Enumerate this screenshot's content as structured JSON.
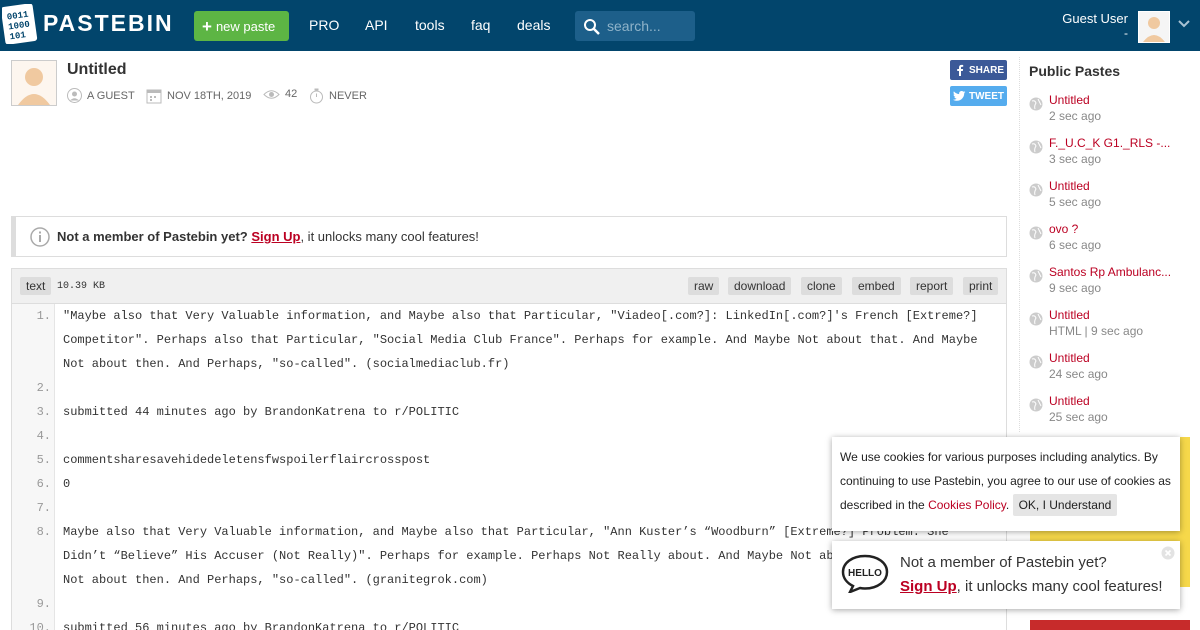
{
  "header": {
    "logo_text": "PASTEBIN",
    "new_paste": "new paste",
    "nav": [
      "PRO",
      "API",
      "tools",
      "faq",
      "deals"
    ],
    "search_placeholder": "search...",
    "user_name": "Guest User",
    "user_sub": "-"
  },
  "paste": {
    "title": "Untitled",
    "author": "A GUEST",
    "date": "NOV 18TH, 2019",
    "views": "42",
    "expires": "NEVER",
    "share_fb": "SHARE",
    "share_tw": "TWEET"
  },
  "notice": {
    "bold": "Not a member of Pastebin yet?",
    "link": "Sign Up",
    "rest": ", it unlocks many cool features!"
  },
  "code": {
    "format": "text",
    "size": "10.39 KB",
    "actions": [
      "raw",
      "download",
      "clone",
      "embed",
      "report",
      "print"
    ],
    "lines": [
      {
        "n": "1.",
        "text": "\"Maybe also that Very Valuable information, and Maybe also that Particular, \"Viadeo[.com?]: LinkedIn[.com?]'s French [Extreme?] Competitor\". Perhaps also that Particular, \"Social Media Club France\". Perhaps for example. And Maybe Not about that. And Maybe Not about then. And Perhaps, \"so-called\". (socialmediaclub.fr)"
      },
      {
        "n": "2.",
        "text": ""
      },
      {
        "n": "3.",
        "text": "submitted 44 minutes ago by BrandonKatrena to r/POLITIC"
      },
      {
        "n": "4.",
        "text": ""
      },
      {
        "n": "5.",
        "text": "commentsharesavehidedeletensfwspoilerflaircrosspost"
      },
      {
        "n": "6.",
        "text": "0"
      },
      {
        "n": "7.",
        "text": ""
      },
      {
        "n": "8.",
        "text": "Maybe also that Very Valuable information, and Maybe also that Particular, \"Ann Kuster’s “Woodburn” [Extreme?] Problem: She Didn’t “Believe” His Accuser (Not Really)\". Perhaps for example. Perhaps Not Really about. And Maybe Not about then. And Maybe Not about then. And Perhaps, \"so-called\". (granitegrok.com)"
      },
      {
        "n": "9.",
        "text": ""
      },
      {
        "n": "10.",
        "text": "submitted 56 minutes ago by BrandonKatrena to r/POLITIC"
      }
    ]
  },
  "sidebar": {
    "title": "Public Pastes",
    "items": [
      {
        "name": "Untitled",
        "time": "2 sec ago"
      },
      {
        "name": "F._U.C_K G1._RLS -...",
        "time": "3 sec ago"
      },
      {
        "name": "Untitled",
        "time": "5 sec ago"
      },
      {
        "name": "ovo ?",
        "time": "6 sec ago"
      },
      {
        "name": "Santos Rp Ambulanc...",
        "time": "9 sec ago"
      },
      {
        "name": "Untitled",
        "time": "HTML | 9 sec ago"
      },
      {
        "name": "Untitled",
        "time": "24 sec ago"
      },
      {
        "name": "Untitled",
        "time": "25 sec ago"
      }
    ]
  },
  "cookie": {
    "text": "We use cookies for various purposes including analytics. By continuing to use Pastebin, you agree to our use of cookies as described in the",
    "link": "Cookies Policy",
    "dot": ".",
    "button": "OK, I Understand"
  },
  "popup": {
    "line1": "Not a member of Pastebin yet?",
    "link": "Sign Up",
    "rest": ", it unlocks many cool features!"
  },
  "colors": {
    "header_bg": "#02456c",
    "new_paste_green": "#5db544",
    "link_red": "#bb0022",
    "facebook": "#3b5998",
    "twitter": "#55acee"
  }
}
